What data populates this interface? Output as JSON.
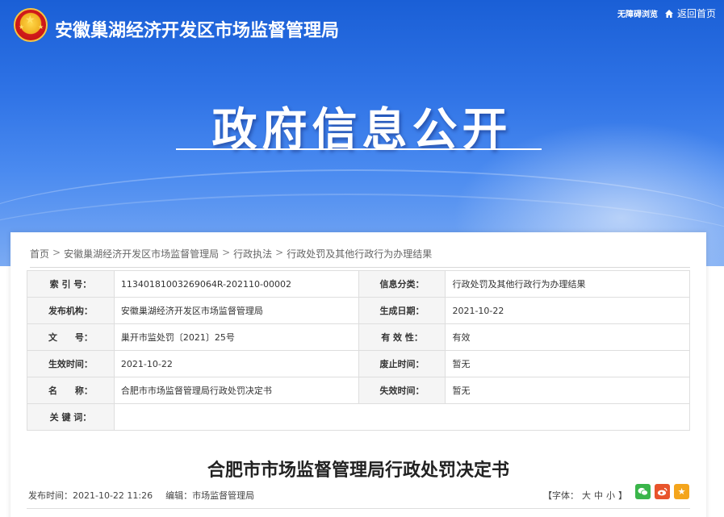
{
  "header": {
    "site_title": "安徽巢湖经济开发区市场监督管理局",
    "barrier_free": "无障碍浏览",
    "back_home": "返回首页",
    "hero_title": "政府信息公开"
  },
  "breadcrumb": {
    "items": [
      "首页",
      "安徽巢湖经济开发区市场监督管理局",
      "行政执法",
      "行政处罚及其他行政行为办理结果"
    ],
    "separator": ">"
  },
  "meta": {
    "rows": [
      {
        "l1": "索 引 号：",
        "v1": "11340181003269064R-202110-00002",
        "l2": "信息分类：",
        "v2": "行政处罚及其他行政行为办理结果"
      },
      {
        "l1": "发布机构：",
        "v1": "安徽巢湖经济开发区市场监督管理局",
        "l2": "生成日期：",
        "v2": "2021-10-22"
      },
      {
        "l1": "文　　号：",
        "v1": "巢开市监处罚〔2021〕25号",
        "l2": "有 效 性：",
        "v2": "有效"
      },
      {
        "l1": "生效时间：",
        "v1": "2021-10-22",
        "l2": "废止时间：",
        "v2": "暂无"
      },
      {
        "l1": "名　　称：",
        "v1": "合肥市市场监督管理局行政处罚决定书",
        "l2": "失效时间：",
        "v2": "暂无"
      }
    ],
    "keywords_label": "关 键 词：",
    "keywords_value": ""
  },
  "document": {
    "title": "合肥市市场监督管理局行政处罚决定书",
    "publish_time_label": "发布时间：",
    "publish_time": "2021-10-22 11:26",
    "editor_label": "编辑：",
    "editor": "市场监督管理局",
    "font_size_label": "【字体：",
    "font_large": "大",
    "font_medium": "中",
    "font_small": "小",
    "font_size_end": "】"
  },
  "colors": {
    "banner_top": "#1a5fd6",
    "wechat": "#3ab54a",
    "weibo": "#e8542c",
    "favorite": "#f4a51c"
  },
  "icons": {
    "emblem": "national-emblem-icon",
    "home": "home-icon",
    "wechat": "wechat-icon",
    "weibo": "weibo-icon",
    "favorite": "star-icon"
  }
}
